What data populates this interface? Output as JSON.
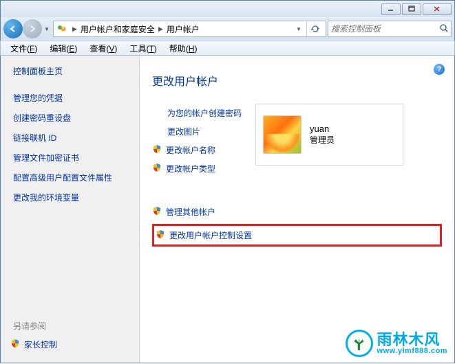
{
  "window": {
    "breadcrumb": [
      "用户帐户和家庭安全",
      "用户帐户"
    ],
    "search_placeholder": "搜索控制面板"
  },
  "menubar": {
    "items": [
      {
        "label": "文件",
        "key": "F"
      },
      {
        "label": "编辑",
        "key": "E"
      },
      {
        "label": "查看",
        "key": "V"
      },
      {
        "label": "工具",
        "key": "T"
      },
      {
        "label": "帮助",
        "key": "H"
      }
    ]
  },
  "sidebar": {
    "title": "控制面板主页",
    "links": [
      "管理您的凭据",
      "创建密码重设盘",
      "链接联机 ID",
      "管理文件加密证书",
      "配置高级用户配置文件属性",
      "更改我的环境变量"
    ],
    "see_also_label": "另请参阅",
    "parental": "家长控制"
  },
  "main": {
    "title": "更改用户帐户",
    "links_group1": [
      {
        "label": "为您的帐户创建密码",
        "shield": false,
        "indent": true
      },
      {
        "label": "更改图片",
        "shield": false,
        "indent": true
      },
      {
        "label": "更改帐户名称",
        "shield": true,
        "indent": false
      },
      {
        "label": "更改帐户类型",
        "shield": true,
        "indent": false
      }
    ],
    "links_group2": [
      {
        "label": "管理其他帐户",
        "shield": true
      },
      {
        "label": "更改用户帐户控制设置",
        "shield": true,
        "highlighted": true
      }
    ],
    "account": {
      "name": "yuan",
      "role": "管理员"
    }
  },
  "watermark": {
    "cn": "雨林木风",
    "url": "www.ylmf888.com"
  }
}
